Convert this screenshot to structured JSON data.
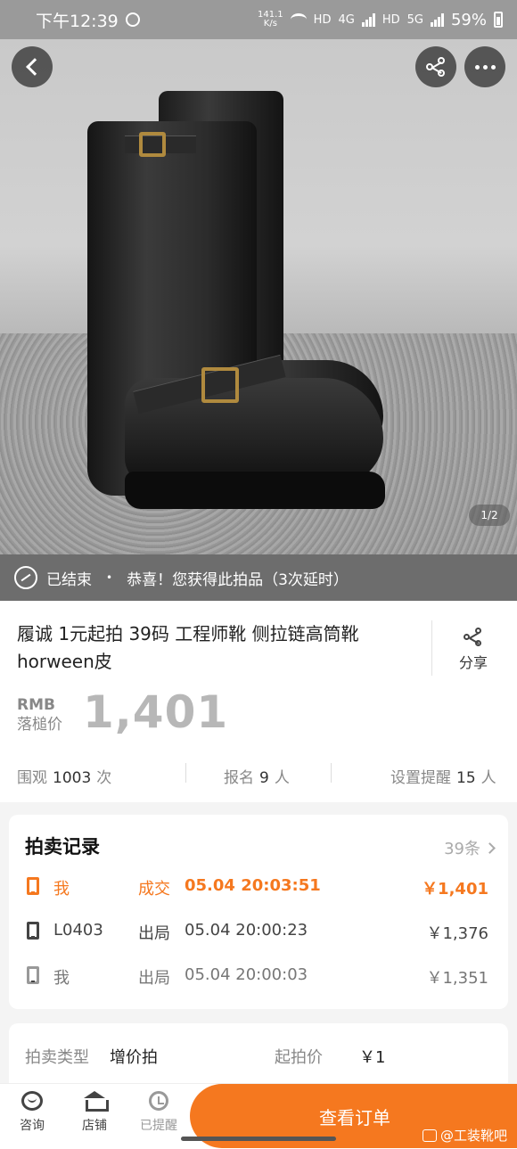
{
  "status_bar": {
    "time": "下午12:39",
    "net_speed_value": "141.1",
    "net_speed_unit": "K/s",
    "hd1": "HD",
    "net1": "4G",
    "hd2": "HD",
    "net2": "5G",
    "battery": "59%"
  },
  "photo": {
    "page_indicator": "1/2"
  },
  "ended_banner": {
    "status": "已结束",
    "separator": "•",
    "message": "恭喜！您获得此拍品（3次延时）"
  },
  "item": {
    "title": "履诚 1元起拍 39码 工程师靴 侧拉链高筒靴horween皮",
    "share_label": "分享",
    "currency": "RMB",
    "price_label": "落槌价",
    "final_price": "1,401"
  },
  "stats": {
    "views_label": "围观",
    "views_value": "1003",
    "views_unit": "次",
    "signups_label": "报名",
    "signups_value": "9",
    "signups_unit": "人",
    "reminders_label": "设置提醒",
    "reminders_value": "15",
    "reminders_unit": "人"
  },
  "records": {
    "title": "拍卖记录",
    "count": "39条",
    "rows": [
      {
        "bidder": "我",
        "type": "成交",
        "time": "05.04 20:03:51",
        "price": "￥1,401"
      },
      {
        "bidder": "L0403",
        "type": "出局",
        "time": "05.04 20:00:23",
        "price": "￥1,376"
      },
      {
        "bidder": "我",
        "type": "出局",
        "time": "05.04 20:00:03",
        "price": "￥1,351"
      }
    ]
  },
  "details": {
    "auction_type_label": "拍卖类型",
    "auction_type_value": "增价拍",
    "start_price_label": "起拍价",
    "start_price_value": "￥1"
  },
  "bottom_bar": {
    "consult": "咨询",
    "store": "店铺",
    "reminded": "已提醒",
    "order_button": "查看订单"
  },
  "watermark": {
    "text": "@工装靴吧"
  },
  "colors": {
    "accent": "#f5781f",
    "banner": "#6d6d6d"
  }
}
